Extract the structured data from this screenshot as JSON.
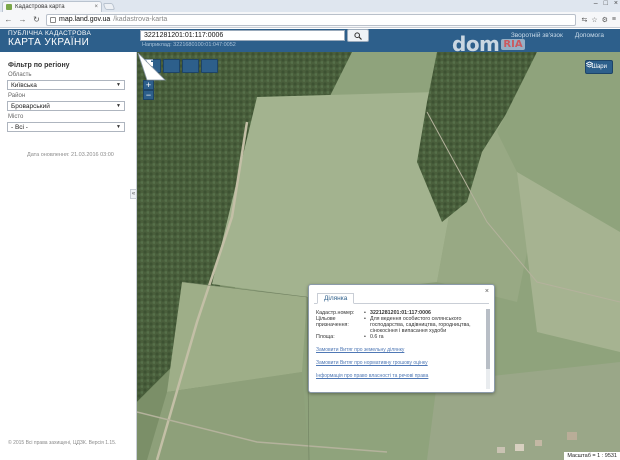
{
  "browser": {
    "tab_title": "Кадастрова карта",
    "url_host": "map.land.gov.ua",
    "url_path": "/kadastrova-karta",
    "window_controls": [
      "–",
      "□",
      "×"
    ]
  },
  "header": {
    "logo_line1": "ПУБЛІЧНА КАДАСТРОВА",
    "logo_line2": "КАРТА УКРАЇНИ",
    "search_value": "3221281201:01:117:0006",
    "search_hint": "Наприклад: 3221680100:01:047:0052",
    "link_feedback": "Зворотній зв'язок",
    "link_help": "Допомога"
  },
  "watermark": {
    "dom": "dom",
    "ria": "RIA"
  },
  "sidebar": {
    "filter_title": "Фільтр по регіону",
    "oblast_label": "Область",
    "oblast_value": "Київська",
    "rayon_label": "Район",
    "rayon_value": "Броварський",
    "misto_label": "Місто",
    "misto_value": "- Всі -",
    "update_date": "Дата оновлення: 21.03.2016 03:00",
    "copyright": "© 2015 Всі права захищені, ЦДЗК. Версія 1.15.",
    "collapse_glyph": "«"
  },
  "map": {
    "layers_label": "Шари",
    "scale_text": "Масштаб = 1 : 9531",
    "zoom_in": "+",
    "zoom_out": "−"
  },
  "popup": {
    "tab_label": "Ділянка",
    "close": "×",
    "rows": [
      {
        "key": "Кадастр.номер:",
        "bullet": "•",
        "value": "3221281201:01:117:0006"
      },
      {
        "key": "Цільове призначення:",
        "bullet": "•",
        "value": "Для ведення особистого селянського господарства, садівництва, городництва, сінокосіння і випасання худоби"
      },
      {
        "key": "Площа:",
        "bullet": "•",
        "value": "0.6 га"
      }
    ],
    "links": [
      "Замовити Витяг про земельну ділянку",
      "Замовити Витяг про нормативну грошову оцінку",
      "Інформація про право власності та речові права"
    ]
  },
  "colors": {
    "accent": "#2d5f8b",
    "link": "#4f78b5"
  }
}
